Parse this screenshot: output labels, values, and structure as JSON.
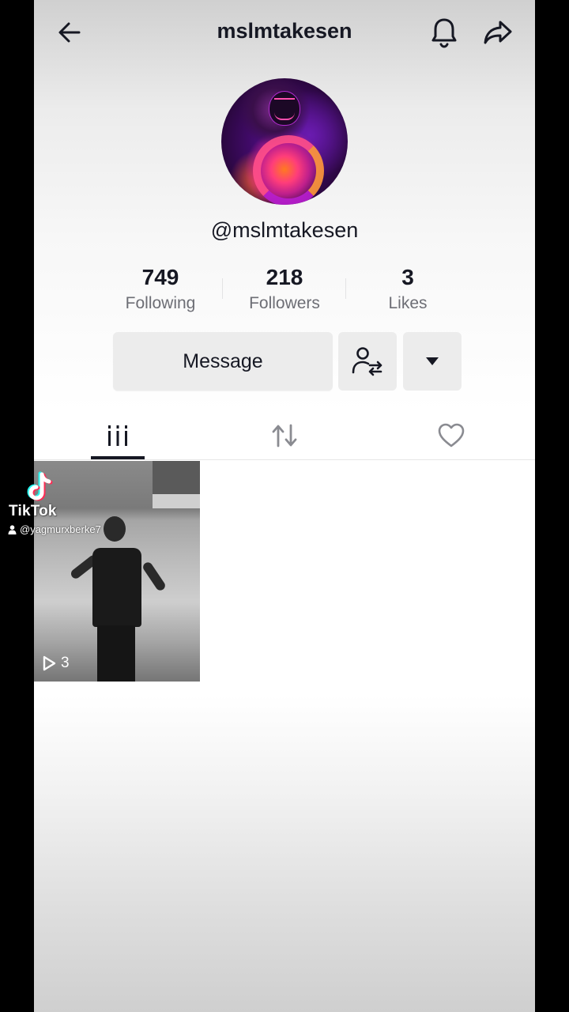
{
  "header": {
    "title": "mslmtakesen"
  },
  "profile": {
    "username": "@mslmtakesen"
  },
  "stats": {
    "following": {
      "value": "749",
      "label": "Following"
    },
    "followers": {
      "value": "218",
      "label": "Followers"
    },
    "likes": {
      "value": "3",
      "label": "Likes"
    }
  },
  "actions": {
    "message_label": "Message"
  },
  "videos": [
    {
      "views": "3"
    }
  ],
  "watermark": {
    "brand": "TikTok",
    "handle": "@yagmurxberke7"
  },
  "colors": {
    "text_primary": "#161823",
    "text_secondary": "#6d6e75",
    "button_bg": "#ececec"
  },
  "icons": {
    "back": "arrow-left-icon",
    "bell": "bell-icon",
    "share": "share-arrow-icon",
    "friends": "user-switch-icon",
    "more": "caret-down-icon",
    "tab_videos": "grid-bars-icon",
    "tab_reposts": "repost-icon",
    "tab_liked": "heart-icon",
    "play": "play-outline-icon"
  }
}
